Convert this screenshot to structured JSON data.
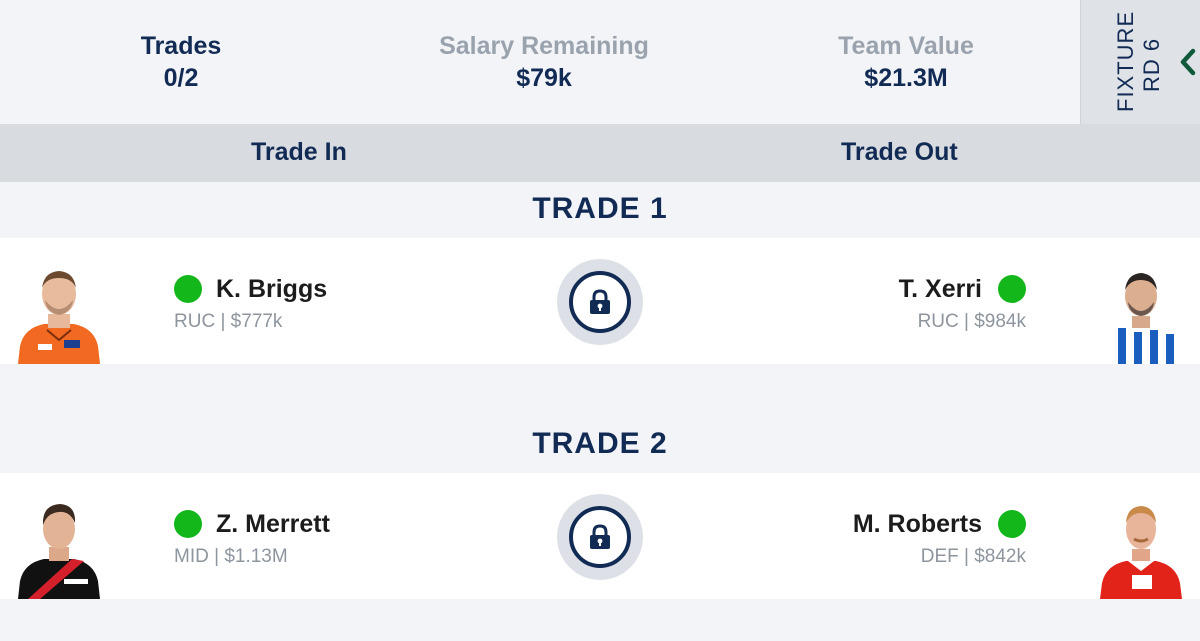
{
  "stats": {
    "trades_label": "Trades",
    "trades_value": "0/2",
    "salary_label": "Salary Remaining",
    "salary_value": "$79k",
    "team_value_label": "Team Value",
    "team_value_value": "$21.3M"
  },
  "fixture": {
    "line1": "FIXTURE",
    "line2": "RD 6",
    "icon": "chevron-left-icon"
  },
  "columns": {
    "trade_in": "Trade In",
    "trade_out": "Trade Out"
  },
  "trades": [
    {
      "title": "TRADE 1",
      "in": {
        "name": "K. Briggs",
        "meta": "RUC | $777k",
        "status_color": "#14b71a",
        "jersey": "orange"
      },
      "out": {
        "name": "T. Xerri",
        "meta": "RUC | $984k",
        "status_color": "#14b71a",
        "jersey": "blue-white"
      },
      "lock_icon": "lock-icon"
    },
    {
      "title": "TRADE 2",
      "in": {
        "name": "Z. Merrett",
        "meta": "MID | $1.13M",
        "status_color": "#14b71a",
        "jersey": "black-red"
      },
      "out": {
        "name": "M. Roberts",
        "meta": "DEF | $842k",
        "status_color": "#14b71a",
        "jersey": "red-white"
      },
      "lock_icon": "lock-icon"
    }
  ],
  "colors": {
    "navy": "#122b55",
    "muted": "#9aa3ad",
    "status_green": "#14b71a",
    "header_bg": "#d8dbe0",
    "page_bg": "#f2f4f7"
  }
}
